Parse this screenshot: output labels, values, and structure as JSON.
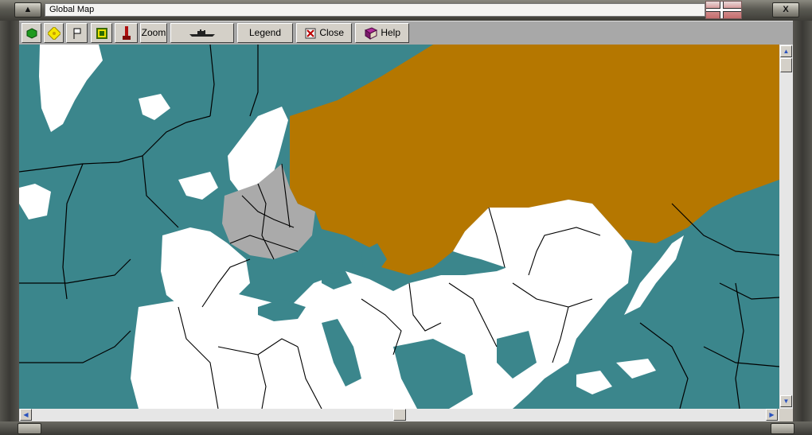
{
  "window": {
    "title": "Global Map",
    "left_button_glyph": "▲",
    "close_button_glyph": "X"
  },
  "flag": {
    "icon": "iron-cross-flag-icon"
  },
  "toolbar": {
    "buttons": [
      {
        "id": "terrain",
        "icon": "green-hexagon-icon",
        "label": ""
      },
      {
        "id": "resources",
        "icon": "yellow-pin-icon",
        "label": ""
      },
      {
        "id": "flags",
        "icon": "white-flag-icon",
        "label": ""
      },
      {
        "id": "cities",
        "icon": "building-icon",
        "label": ""
      },
      {
        "id": "units",
        "icon": "red-figure-icon",
        "label": ""
      },
      {
        "id": "zoom",
        "icon": "",
        "label": "Zoom"
      },
      {
        "id": "fleet",
        "icon": "ship-icon",
        "label": ""
      },
      {
        "id": "legend",
        "icon": "",
        "label": "Legend"
      },
      {
        "id": "close",
        "icon": "close-doc-icon",
        "label": "Close"
      },
      {
        "id": "help",
        "icon": "help-book-icon",
        "label": "Help"
      }
    ]
  },
  "map": {
    "colors": {
      "ocean": "#3b868c",
      "neutral_land": "#ffffff",
      "allied": "#b57700",
      "axis": "#aaaaaa",
      "border": "#000000"
    }
  },
  "scrollbars": {
    "vertical": {
      "up_glyph": "▲",
      "down_glyph": "▼"
    },
    "horizontal": {
      "left_glyph": "◀",
      "right_glyph": "▶"
    }
  }
}
